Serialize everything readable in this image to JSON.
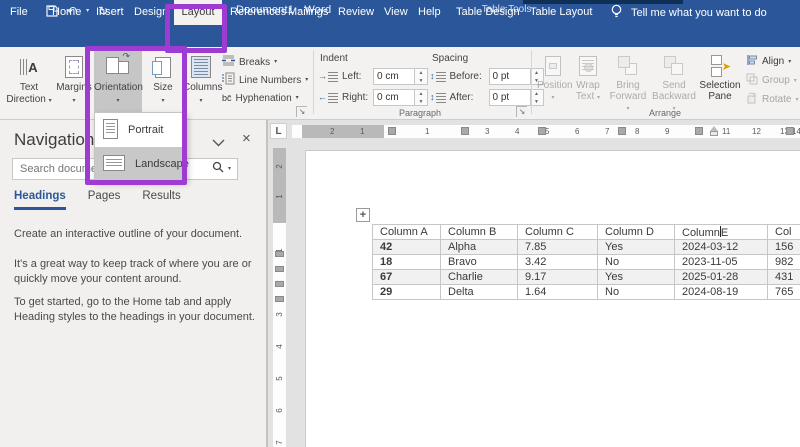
{
  "title_bar": {
    "title": "Document1  -  Word",
    "context_label": "Table Tools"
  },
  "glyphs": {
    "caret": "▾",
    "undo": "↶",
    "redo": "↻",
    "qat_customize": "▾",
    "close": "×",
    "plus_handle": "+",
    "tab_selector": "L",
    "launcher": "↘"
  },
  "tabs": {
    "items": [
      "File",
      "Home",
      "Insert",
      "Design",
      "Layout",
      "References",
      "Mailings",
      "Review",
      "View",
      "Help"
    ],
    "active": "Layout",
    "contextual": [
      "Table Design",
      "Table Layout"
    ],
    "tell_me": "Tell me what you want to do"
  },
  "ribbon": {
    "page_setup": {
      "text_direction_line1": "Text",
      "text_direction_line2": "Direction",
      "margins": "Margins",
      "orientation": "Orientation",
      "size": "Size",
      "columns": "Columns",
      "breaks": "Breaks",
      "line_numbers": "Line Numbers",
      "hyphenation": "Hyphenation"
    },
    "paragraph": {
      "group_label": "Paragraph",
      "indent_label": "Indent",
      "spacing_label": "Spacing",
      "left_label": "Left:",
      "left_value": "0 cm",
      "right_label": "Right:",
      "right_value": "0 cm",
      "before_label": "Before:",
      "before_value": "0 pt",
      "after_label": "After:",
      "after_value": "0 pt"
    },
    "arrange": {
      "group_label": "Arrange",
      "position": "Position",
      "wrap_line1": "Wrap",
      "wrap_line2": "Text",
      "bring_line1": "Bring",
      "bring_line2": "Forward",
      "send_line1": "Send",
      "send_line2": "Backward",
      "selection_line1": "Selection",
      "selection_line2": "Pane",
      "align": "Align",
      "group": "Group",
      "rotate": "Rotate"
    }
  },
  "orientation_menu": {
    "portrait": "Portrait",
    "landscape": "Landscape",
    "selected": "Landscape"
  },
  "navigation": {
    "title": "Navigation",
    "search_placeholder": "Search document",
    "tabs": [
      "Headings",
      "Pages",
      "Results"
    ],
    "active_tab": "Headings",
    "paragraphs": [
      "Create an interactive outline of your document.",
      "It's a great way to keep track of where you are or quickly move your content around.",
      "To get started, go to the Home tab and apply Heading styles to the headings in your document."
    ]
  },
  "document": {
    "ruler_h": {
      "margin_numbers": [
        "2",
        "1"
      ],
      "numbers": [
        "1",
        "3",
        "4",
        "5",
        "6",
        "7",
        "8",
        "9",
        "11",
        "12",
        "13",
        "14"
      ]
    },
    "ruler_v": {
      "margin_numbers": [
        "2",
        "1"
      ],
      "numbers": [
        "1",
        "2",
        "3",
        "4",
        "5",
        "6",
        "7"
      ]
    },
    "table": {
      "headers": [
        "Column A",
        "Column B",
        "Column C",
        "Column D",
        "Column E",
        "Col"
      ],
      "header_e_pre": "Column",
      "header_e_post": "E",
      "rows": [
        [
          "42",
          "Alpha",
          "7.85",
          "Yes",
          "2024-03-12",
          "156"
        ],
        [
          "18",
          "Bravo",
          "3.42",
          "No",
          "2023-11-05",
          "982"
        ],
        [
          "67",
          "Charlie",
          "9.17",
          "Yes",
          "2025-01-28",
          "431"
        ],
        [
          "29",
          "Delta",
          "1.64",
          "No",
          "2024-08-19",
          "765"
        ]
      ]
    }
  },
  "colors": {
    "accent": "#2b579a",
    "contextual_bg": "#1f4a7d",
    "highlight_purple": "#9d3bd2",
    "selection_gray": "#c6c6c6"
  }
}
